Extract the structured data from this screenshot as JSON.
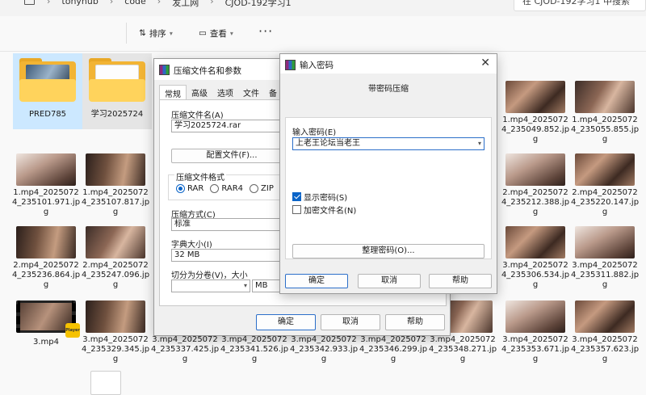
{
  "explorer": {
    "breadcrumbs": [
      "tonyhub",
      "code",
      "发工网",
      "CJOD-192学习1"
    ],
    "search_placeholder": "在 CJOD-192学习1 中搜索",
    "toolbar": {
      "sort_label": "排序",
      "view_label": "查看",
      "more_label": "···"
    },
    "folders": [
      {
        "name": "PRED785"
      },
      {
        "name": "学习2025724"
      }
    ],
    "files": {
      "row1_right": [
        "1.mp4_20250724_235049.852.jpg",
        "1.mp4_20250724_235055.855.jpg"
      ],
      "row2_left": [
        "1.mp4_20250724_235101.971.jpg",
        "1.mp4_20250724_235107.817.jpg"
      ],
      "row2_right": [
        "2.mp4_20250724_235212.388.jpg",
        "2.mp4_20250724_235220.147.jpg"
      ],
      "row3_left": [
        "2.mp4_20250724_235236.864.jpg",
        "2.mp4_20250724_235247.096.jpg"
      ],
      "row3_right": [
        "3.mp4_20250724_235306.534.jpg",
        "3.mp4_20250724_235311.882.jpg"
      ],
      "row4": [
        "3.mp4",
        "3.mp4_20250724_235329.345.jpg",
        "3.mp4_20250724_235337.425.jpg",
        "3.mp4_20250724_235341.526.jpg",
        "3.mp4_20250724_235342.933.jpg",
        "3.mp4_20250724_235346.299.jpg",
        "3.mp4_20250724_235348.271.jpg",
        "3.mp4_20250724_235353.671.jpg",
        "3.mp4_20250724_235357.623.jpg"
      ],
      "video_badge": "Player"
    }
  },
  "archive_dialog": {
    "title": "压缩文件名和参数",
    "tabs": [
      "常规",
      "高级",
      "选项",
      "文件",
      "备"
    ],
    "archive_name_label": "压缩文件名(A)",
    "archive_name_value": "学习2025724.rar",
    "profiles_button": "配置文件(F)...",
    "format_label": "压缩文件格式",
    "formats": [
      "RAR",
      "RAR4",
      "ZIP"
    ],
    "selected_format": "RAR",
    "method_label": "压缩方式(C)",
    "method_value": "标准",
    "dict_label": "字典大小(I)",
    "dict_value": "32 MB",
    "split_label": "切分为分卷(V)，大小",
    "split_unit": "MB",
    "ok": "确定",
    "cancel": "取消",
    "help": "帮助"
  },
  "password_dialog": {
    "title": "输入密码",
    "subtitle": "带密码压缩",
    "password_label": "输入密码(E)",
    "password_value": "上老王论坛当老王",
    "show_password_label": "显示密码(S)",
    "show_password_checked": true,
    "encrypt_names_label": "加密文件名(N)",
    "encrypt_names_checked": false,
    "organize_button": "整理密码(O)...",
    "ok": "确定",
    "cancel": "取消",
    "help": "帮助",
    "close_icon": "close-icon"
  },
  "colors": {
    "accent": "#0a64c8",
    "selection": "#cce8ff",
    "folder": "#f2b434"
  }
}
